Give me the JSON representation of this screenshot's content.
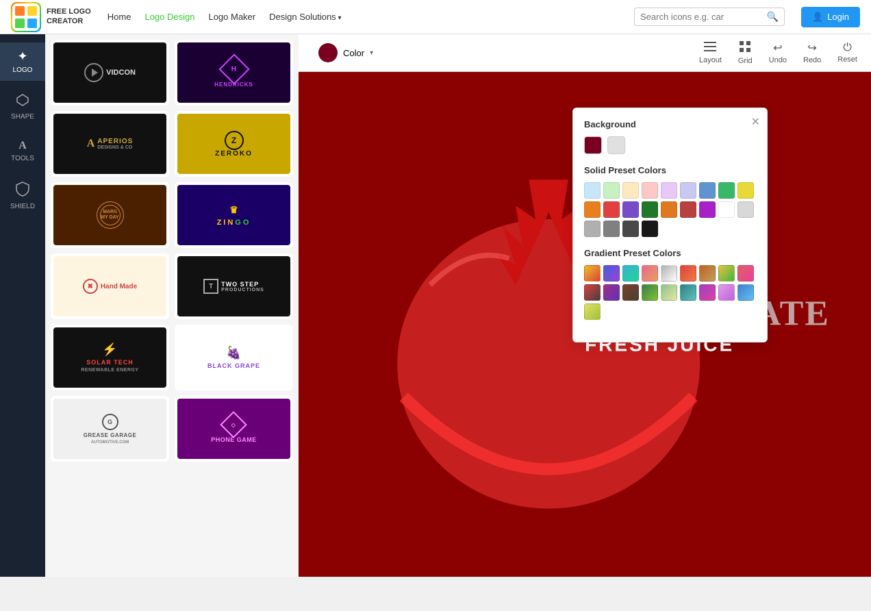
{
  "brand": {
    "name_line1": "FREE LOGO",
    "name_line2": "CREATOR"
  },
  "nav": {
    "home": "Home",
    "logo_design": "Logo Design",
    "logo_maker": "Logo Maker",
    "design_solutions": "Design Solutions",
    "search_placeholder": "Search icons e.g. car",
    "login": "Login"
  },
  "sidebar": {
    "items": [
      {
        "id": "logo",
        "label": "LOGO",
        "icon": "✦",
        "active": true
      },
      {
        "id": "shape",
        "label": "SHAPE",
        "icon": "⬡"
      },
      {
        "id": "tools",
        "label": "TOOLS",
        "icon": "A"
      },
      {
        "id": "shield",
        "label": "SHIELD",
        "icon": "🛡"
      }
    ]
  },
  "toolbar": {
    "color_label": "Color",
    "layout_label": "Layout",
    "grid_label": "Grid",
    "undo_label": "Undo",
    "redo_label": "Redo",
    "reset_label": "Reset"
  },
  "canvas": {
    "title": "MEGRANATE",
    "subtitle": "FRESH JUICE"
  },
  "color_picker": {
    "title": "Background",
    "solid_title": "Solid Preset Colors",
    "gradient_title": "Gradient Preset Colors",
    "solid_colors": [
      "#c8e6fa",
      "#c8f0c0",
      "#fde8c0",
      "#fdc8c8",
      "#e8c8f8",
      "#c8c8f0",
      "#6094d0",
      "#38b868",
      "#e8d838",
      "#e88020",
      "#e04040",
      "#784cc8",
      "#207828",
      "#e07820",
      "#b84040",
      "#a820c8",
      "#ffffff",
      "#d8d8d8",
      "#b0b0b0",
      "#808080",
      "#484848",
      "#181818"
    ],
    "gradient_colors": [
      "#e8c020,#e04040",
      "#4060d8,#a040d8",
      "#38b0d8,#20d890",
      "#e86890,#e8a060",
      "#b0b0b0,#ffffff",
      "#e04040,#e88040",
      "#c06020,#c0a060",
      "#e8c040,#40b840",
      "#e06060,#e840a0",
      "#e04040,#404040",
      "#a03080,#6030c0",
      "#784030,#484030",
      "#388050,#80c030",
      "#90c090,#e0e8a0",
      "#308080,#60c0c0",
      "#a040c0,#e040a0",
      "#e0a0e0,#c060e0",
      "#4080d0,#60c0f0",
      "#e0e060,#a0c040"
    ]
  },
  "gallery": {
    "logos": [
      {
        "id": "vidcon",
        "name": "VIDCON",
        "bg": "#111111",
        "text_color": "#ffffff"
      },
      {
        "id": "hendricks",
        "name": "HENDRICKS",
        "bg": "#1a0033",
        "text_color": "#cc44ff"
      },
      {
        "id": "aperios",
        "name": "APERIOS",
        "bg": "#111111",
        "text_color": "#ccaa44"
      },
      {
        "id": "zeroko",
        "name": "ZEROKO",
        "bg": "#c8a800",
        "text_color": "#111111"
      },
      {
        "id": "mars",
        "name": "MARS MY DAY",
        "bg": "#4a2000",
        "text_color": "#cc8844"
      },
      {
        "id": "zingo",
        "name": "ZINGO",
        "bg": "#1a0066",
        "text_color": "#ffcc00"
      },
      {
        "id": "handmade",
        "name": "Hand Made",
        "bg": "#fef5e0",
        "text_color": "#cc4444"
      },
      {
        "id": "twostep",
        "name": "TWO STEP",
        "bg": "#111111",
        "text_color": "#ffffff"
      },
      {
        "id": "solartech",
        "name": "SOLAR TECH",
        "bg": "#111111",
        "text_color": "#ff4444"
      },
      {
        "id": "blackgrape",
        "name": "BLACK GRAPE",
        "bg": "#ffffff",
        "text_color": "#8844cc"
      },
      {
        "id": "garage",
        "name": "GREASE GARAGE",
        "bg": "#f0f0f0",
        "text_color": "#333333"
      },
      {
        "id": "phonegame",
        "name": "PHONE GAME",
        "bg": "#6a0077",
        "text_color": "#ff88ff"
      }
    ]
  }
}
